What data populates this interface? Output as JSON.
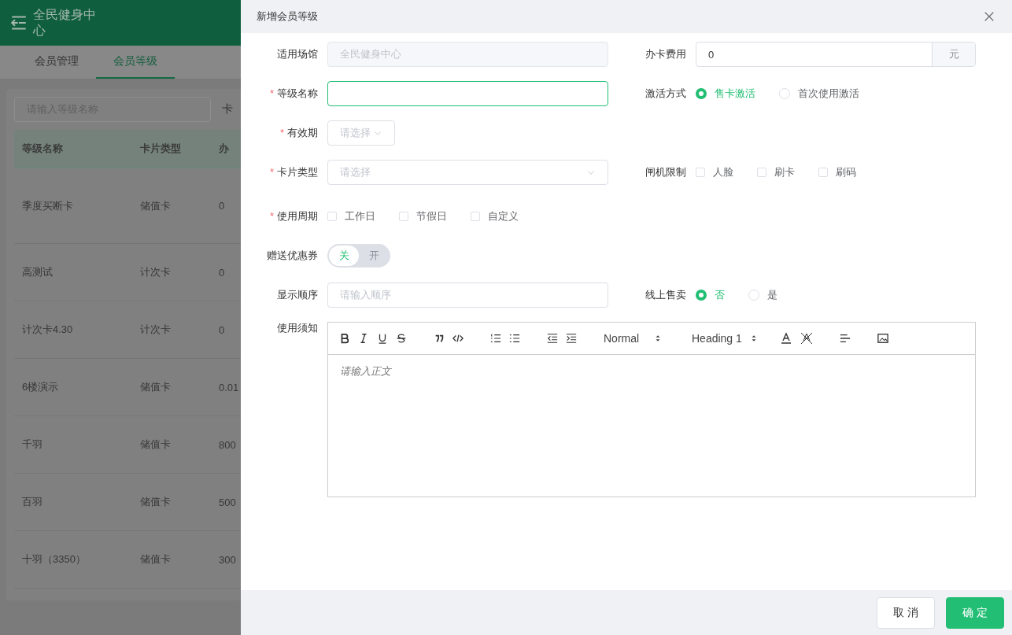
{
  "background": {
    "header": {
      "title": "全民健身中心"
    },
    "tabs": [
      {
        "label": "会员管理",
        "selected": false
      },
      {
        "label": "会员等级",
        "selected": true
      }
    ],
    "search": {
      "placeholder": "请输入等级名称"
    },
    "filter_label": "卡",
    "table": {
      "columns": [
        "等级名称",
        "卡片类型",
        "办"
      ],
      "rows": [
        [
          "季度买断卡",
          "储值卡",
          "0"
        ],
        [
          "高测试",
          "计次卡",
          "0"
        ],
        [
          "计次卡4.30",
          "计次卡",
          "0"
        ],
        [
          "6楼演示",
          "储值卡",
          "0.01"
        ],
        [
          "千羽",
          "储值卡",
          "800"
        ],
        [
          "百羽",
          "储值卡",
          "500"
        ],
        [
          "十羽（3350）",
          "储值卡",
          "300"
        ]
      ]
    }
  },
  "drawer": {
    "title": "新增会员等级",
    "rows": [
      {
        "left": {
          "label": "适用场馆",
          "kind": "input",
          "value": "全民健身中心",
          "disabled": true
        },
        "right": {
          "label": "办卡费用",
          "kind": "addon-input",
          "value": "0",
          "addon": "元"
        }
      },
      {
        "left": {
          "label": "等级名称",
          "required_mark": "*",
          "kind": "input",
          "focused": true
        },
        "right": {
          "label": "激活方式",
          "kind": "radios",
          "options": [
            {
              "label": "售卡激活",
              "selected": true
            },
            {
              "label": "首次使用激活",
              "selected": false
            }
          ]
        }
      },
      {
        "left": {
          "label": "有效期",
          "required_mark": "*",
          "kind": "select",
          "placeholder": "请选择",
          "compact": true
        }
      },
      {
        "left": {
          "label": "卡片类型",
          "required_mark": "*",
          "kind": "select",
          "placeholder": "请选择"
        },
        "right": {
          "label": "闸机限制",
          "kind": "checkboxes",
          "options": [
            {
              "label": "人脸",
              "checked": false
            },
            {
              "label": "刷卡",
              "checked": false
            },
            {
              "label": "刷码",
              "checked": false
            }
          ]
        }
      },
      {
        "left": {
          "label": "使用周期",
          "required_mark": "*",
          "kind": "checkboxes",
          "options": [
            {
              "label": "工作日",
              "checked": false
            },
            {
              "label": "节假日",
              "checked": false
            },
            {
              "label": "自定义",
              "checked": false
            }
          ]
        }
      },
      {
        "left": {
          "label": "赠送优惠券",
          "kind": "switch",
          "off_label": "关",
          "on_label": "开",
          "on": false
        }
      },
      {
        "left": {
          "label": "显示顺序",
          "kind": "input",
          "placeholder": "请输入顺序"
        },
        "right": {
          "label": "线上售卖",
          "kind": "radios",
          "options": [
            {
              "label": "否",
              "selected": true
            },
            {
              "label": "是",
              "selected": false
            }
          ]
        }
      }
    ],
    "editor": {
      "label": "使用须知",
      "format_select": "Normal",
      "heading_select": "Heading 1",
      "placeholder": "请输入正文"
    },
    "buttons": [
      {
        "label": "取 消",
        "kind": "default"
      },
      {
        "label": "确 定",
        "kind": "primary"
      }
    ]
  }
}
